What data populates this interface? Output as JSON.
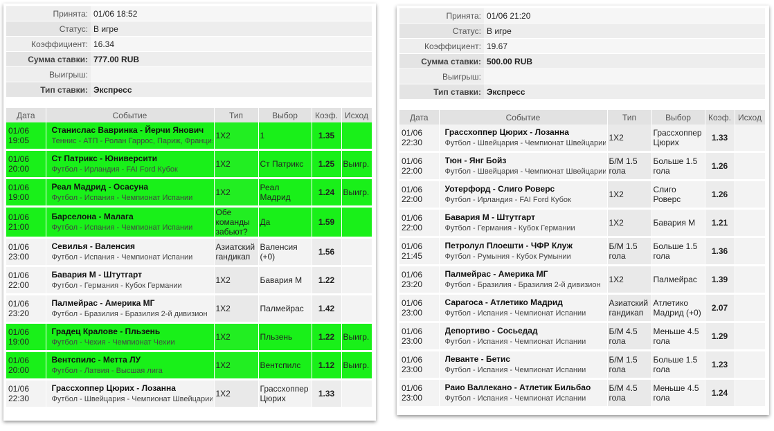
{
  "labels": {
    "accepted": "Принята:",
    "status": "Статус:",
    "coef": "Коэффициент:",
    "stake": "Сумма ставки:",
    "win": "Выигрыш:",
    "bet_type": "Тип ставки:"
  },
  "headers": [
    "Дата",
    "Событие",
    "Тип",
    "Выбор",
    "Коэф.",
    "Исход"
  ],
  "left": {
    "info": {
      "accepted": "01/06 18:52",
      "status": "В игре",
      "coef": "16.34",
      "stake": "777.00 RUB",
      "win": "",
      "bet_type": "Экспресс"
    },
    "rows": [
      {
        "date": "01/06",
        "time": "19:05",
        "event": "Станислас Вавринка - Йерчи Янович",
        "sub": "Теннис - АТП - Ролан Гаррос, Париж, Франция",
        "type": "1X2",
        "choice": "1",
        "coef": "1.35",
        "outcome": "",
        "win": true
      },
      {
        "date": "01/06",
        "time": "20:00",
        "event": "Ст Патрикс - Юниверсити",
        "sub": "Футбол - Ирландия - FAI Ford Кубок",
        "type": "1X2",
        "choice": "Ст Патрикс",
        "coef": "1.25",
        "outcome": "Выигр.",
        "win": true
      },
      {
        "date": "01/06",
        "time": "19:00",
        "event": "Реал Мадрид - Осасуна",
        "sub": "Футбол - Испания - Чемпионат Испании",
        "type": "1X2",
        "choice": "Реал Мадрид",
        "coef": "1.24",
        "outcome": "Выигр.",
        "win": true
      },
      {
        "date": "01/06",
        "time": "21:00",
        "event": "Барселона - Малага",
        "sub": "Футбол - Испания - Чемпионат Испании",
        "type": "Обе команды забьют?",
        "choice": "Да",
        "coef": "1.59",
        "outcome": "",
        "win": true
      },
      {
        "date": "01/06",
        "time": "23:00",
        "event": "Севилья - Валенсия",
        "sub": "Футбол - Испания - Чемпионат Испании",
        "type": "Азиатский гандикап",
        "choice": "Валенсия (+0)",
        "coef": "1.56",
        "outcome": "",
        "win": false
      },
      {
        "date": "01/06",
        "time": "22:00",
        "event": "Бавария М - Штутгарт",
        "sub": "Футбол - Германия - Кубок Германии",
        "type": "1X2",
        "choice": "Бавария М",
        "coef": "1.22",
        "outcome": "",
        "win": false
      },
      {
        "date": "01/06",
        "time": "23:20",
        "event": "Палмейрас - Америка МГ",
        "sub": "Футбол - Бразилия - Бразилия 2-й дивизион",
        "type": "1X2",
        "choice": "Палмейрас",
        "coef": "1.42",
        "outcome": "",
        "win": false
      },
      {
        "date": "01/06",
        "time": "19:00",
        "event": "Градец Кралове - Пльзень",
        "sub": "Футбол - Чехия - Чемпионат Чехии",
        "type": "1X2",
        "choice": "Пльзень",
        "coef": "1.22",
        "outcome": "Выигр.",
        "win": true
      },
      {
        "date": "01/06",
        "time": "20:00",
        "event": "Вентспилс - Метта ЛУ",
        "sub": "Футбол - Латвия - Высшая лига",
        "type": "1X2",
        "choice": "Вентспилс",
        "coef": "1.12",
        "outcome": "Выигр.",
        "win": true
      },
      {
        "date": "01/06",
        "time": "22:30",
        "event": "Грассхоппер Цюрих - Лозанна",
        "sub": "Футбол - Швейцария - Чемпионат Швейцарии",
        "type": "1X2",
        "choice": "Грассхоппер Цюрих",
        "coef": "1.33",
        "outcome": "",
        "win": false
      }
    ]
  },
  "right": {
    "info": {
      "accepted": "01/06 21:20",
      "status": "В игре",
      "coef": "19.67",
      "stake": "500.00 RUB",
      "win": "",
      "bet_type": "Экспресс"
    },
    "rows": [
      {
        "date": "01/06",
        "time": "22:30",
        "event": "Грассхоппер Цюрих - Лозанна",
        "sub": "Футбол - Швейцария - Чемпионат Швейцарии",
        "type": "1X2",
        "choice": "Грассхоппер Цюрих",
        "coef": "1.33",
        "outcome": "",
        "win": false
      },
      {
        "date": "01/06",
        "time": "22:00",
        "event": "Тюн - Янг Бойз",
        "sub": "Футбол - Швейцария - Чемпионат Швейцарии",
        "type": "Б/М 1.5 гола",
        "choice": "Больше 1.5 гола",
        "coef": "1.26",
        "outcome": "",
        "win": false
      },
      {
        "date": "01/06",
        "time": "22:00",
        "event": "Уотерфорд - Слиго Роверс",
        "sub": "Футбол - Ирландия - FAI Ford Кубок",
        "type": "1X2",
        "choice": "Слиго Роверс",
        "coef": "1.26",
        "outcome": "",
        "win": false
      },
      {
        "date": "01/06",
        "time": "22:00",
        "event": "Бавария М - Штутгарт",
        "sub": "Футбол - Германия - Кубок Германии",
        "type": "1X2",
        "choice": "Бавария М",
        "coef": "1.21",
        "outcome": "",
        "win": false
      },
      {
        "date": "01/06",
        "time": "21:45",
        "event": "Петролул Плоешти - ЧФР Клуж",
        "sub": "Футбол - Румыния - Кубок Румынии",
        "type": "Б/М 1.5 гола",
        "choice": "Больше 1.5 гола",
        "coef": "1.36",
        "outcome": "",
        "win": false
      },
      {
        "date": "01/06",
        "time": "23:20",
        "event": "Палмейрас - Америка МГ",
        "sub": "Футбол - Бразилия - Бразилия 2-й дивизион",
        "type": "1X2",
        "choice": "Палмейрас",
        "coef": "1.39",
        "outcome": "",
        "win": false
      },
      {
        "date": "01/06",
        "time": "23:00",
        "event": "Сарагоса - Атлетико Мадрид",
        "sub": "Футбол - Испания - Чемпионат Испании",
        "type": "Азиатский гандикап",
        "choice": "Атлетико Мадрид (+0)",
        "coef": "2.07",
        "outcome": "",
        "win": false
      },
      {
        "date": "01/06",
        "time": "23:00",
        "event": "Депортиво - Сосьедад",
        "sub": "Футбол - Испания - Чемпионат Испании",
        "type": "Б/М 4.5 гола",
        "choice": "Меньше 4.5 гола",
        "coef": "1.29",
        "outcome": "",
        "win": false
      },
      {
        "date": "01/06",
        "time": "23:00",
        "event": "Леванте - Бетис",
        "sub": "Футбол - Испания - Чемпионат Испании",
        "type": "Б/М 1.5 гола",
        "choice": "Больше 1.5 гола",
        "coef": "1.23",
        "outcome": "",
        "win": false
      },
      {
        "date": "01/06",
        "time": "23:00",
        "event": "Раио Валлекано - Атлетик Бильбао",
        "sub": "Футбол - Испания - Чемпионат Испании",
        "type": "Б/М 4.5 гола",
        "choice": "Меньше 4.5 гола",
        "coef": "1.24",
        "outcome": "",
        "win": false
      }
    ]
  }
}
